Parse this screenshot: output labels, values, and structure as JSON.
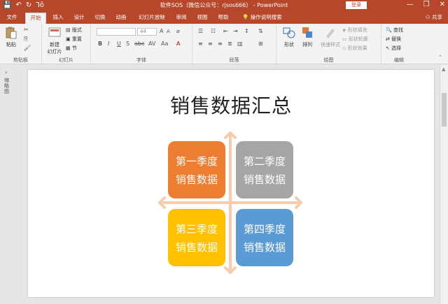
{
  "titlebar": {
    "title": "软件SOS（微信公众号：rjsos666） - PowerPoint",
    "login": "登录",
    "qat_save": "💾",
    "qat_undo": "↶",
    "qat_redo": "↻",
    "qat_start": "Ꞁō",
    "win_min": "—",
    "win_restore": "❐",
    "win_close": "✕"
  },
  "tabs": {
    "items": [
      "文件",
      "开始",
      "插入",
      "设计",
      "切换",
      "动画",
      "幻灯片放映",
      "审阅",
      "视图",
      "帮助"
    ],
    "active": "开始",
    "tellme": "操作说明搜索",
    "share": "共享"
  },
  "ribbon": {
    "clipboard": {
      "label": "剪贴板",
      "paste": "粘贴"
    },
    "slides": {
      "label": "幻灯片",
      "new_slide_1": "新建",
      "new_slide_2": "幻灯片",
      "layout": "版式",
      "reset": "重置",
      "section": "节"
    },
    "font": {
      "label": "字体",
      "size": "44",
      "bold": "B",
      "italic": "I",
      "underline": "U",
      "strike": "S",
      "abc": "abc",
      "av": "AV",
      "aa": "Aa",
      "grow": "A",
      "shrink": "A",
      "color": "A"
    },
    "paragraph": {
      "label": "段落"
    },
    "drawing": {
      "label": "绘图",
      "shape": "形状",
      "arrange": "排列",
      "quick_styles": "快速样式",
      "fill": "形状填充",
      "outline": "形状轮廓",
      "effects": "形状效果"
    },
    "editing": {
      "label": "编辑",
      "find": "查找",
      "replace": "替换",
      "select": "选择"
    }
  },
  "sidepanel": {
    "label": "缩略图"
  },
  "slide": {
    "title": "销售数据汇总",
    "quadrants": [
      {
        "line1": "第一季度",
        "line2": "销售数据",
        "color": "#ed7d31"
      },
      {
        "line1": "第二季度",
        "line2": "销售数据",
        "color": "#a5a5a5"
      },
      {
        "line1": "第三季度",
        "line2": "销售数据",
        "color": "#ffc000"
      },
      {
        "line1": "第四季度",
        "line2": "销售数据",
        "color": "#5b9bd5"
      }
    ],
    "arrow_color": "#f8cbad"
  }
}
